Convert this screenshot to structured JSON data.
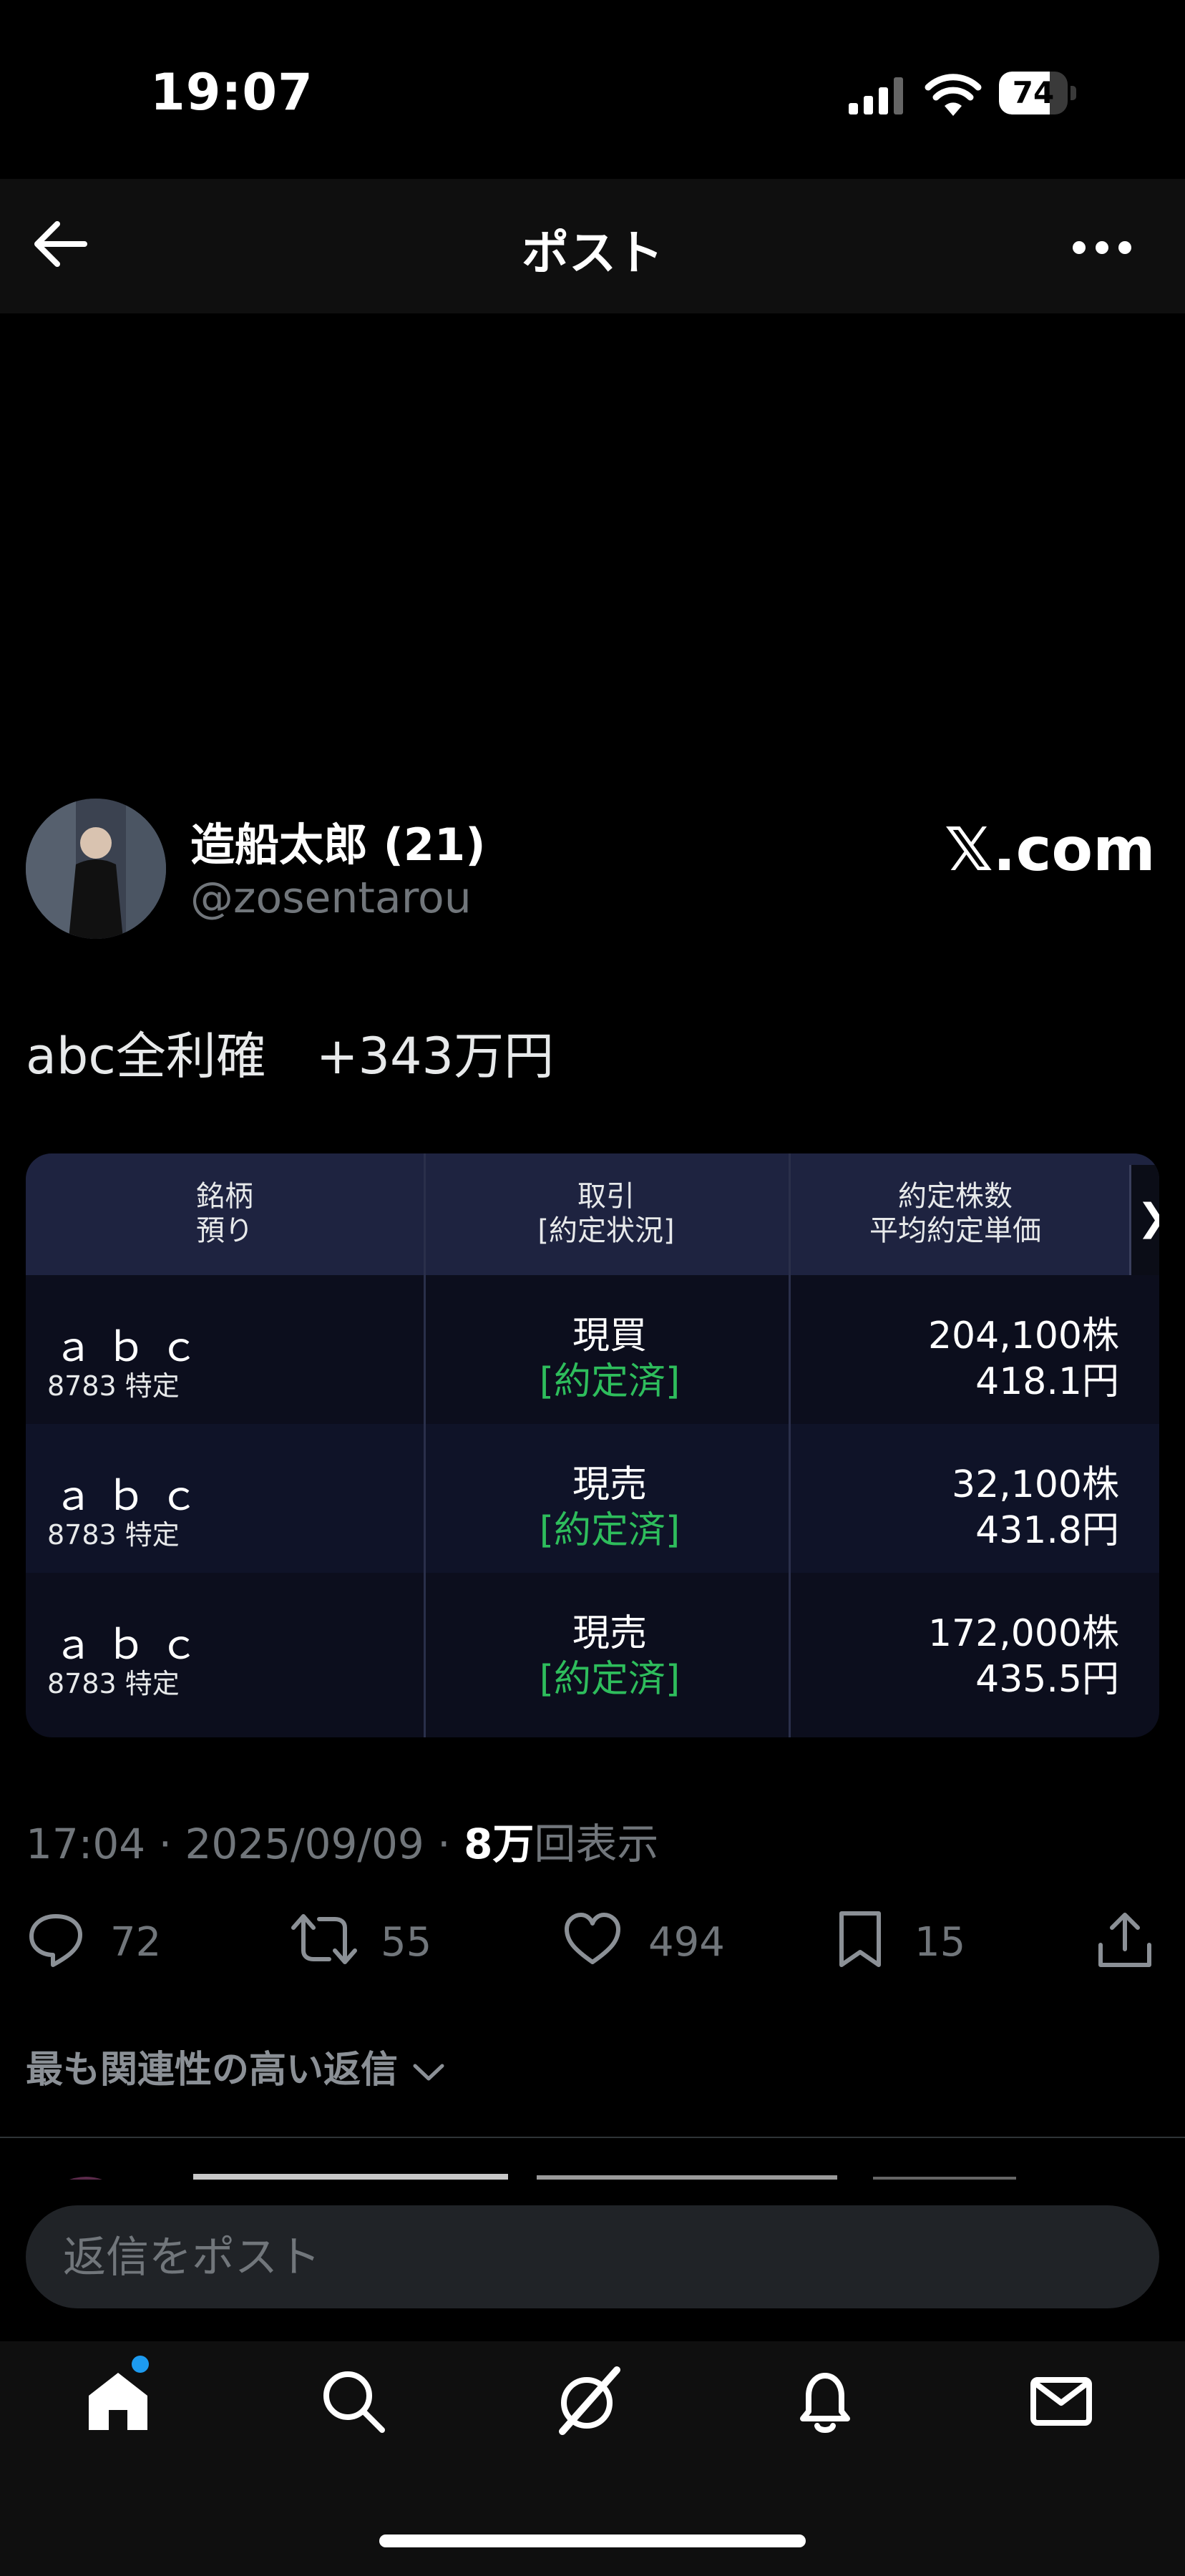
{
  "status_bar": {
    "time": "19:07",
    "battery": "74",
    "battery_level": 0.74
  },
  "header": {
    "title": "ポスト"
  },
  "author": {
    "name": "造船太郎 (21)",
    "handle": "@zosentarou",
    "source": "𝕏.com"
  },
  "post": {
    "text": "abc全利確　+343万円"
  },
  "table": {
    "headers": [
      {
        "line1": "銘柄",
        "line2": "預り"
      },
      {
        "line1": "取引",
        "line2": "[約定状況]"
      },
      {
        "line1": "約定株数",
        "line2": "平均約定単価"
      }
    ],
    "scroll_glyph": "❯",
    "rows": [
      {
        "name": "ａｂｃ",
        "sub": "8783 特定",
        "trade": "現買",
        "status": "[約定済]",
        "qty": "204,100株",
        "price": "418.1円"
      },
      {
        "name": "ａｂｃ",
        "sub": "8783 特定",
        "trade": "現売",
        "status": "[約定済]",
        "qty": "32,100株",
        "price": "431.8円"
      },
      {
        "name": "ａｂｃ",
        "sub": "8783 特定",
        "trade": "現売",
        "status": "[約定済]",
        "qty": "172,000株",
        "price": "435.5円"
      }
    ],
    "status_color": "#2ebd5c"
  },
  "meta": {
    "time_date": "17:04 · 2025/09/09 · ",
    "views_count": "8万",
    "views_label": "回表示"
  },
  "actions": {
    "replies": "72",
    "reposts": "55",
    "likes": "494",
    "bookmarks": "15"
  },
  "replies_sort": {
    "label": "最も関連性の高い返信"
  },
  "reply_box": {
    "placeholder": "返信をポスト"
  },
  "tabs": [
    "home-icon",
    "search-icon",
    "grok-icon",
    "notifications-icon",
    "messages-icon"
  ],
  "colors": {
    "background": "#000000",
    "accent": "#1d9bf0",
    "muted": "#71767b"
  }
}
